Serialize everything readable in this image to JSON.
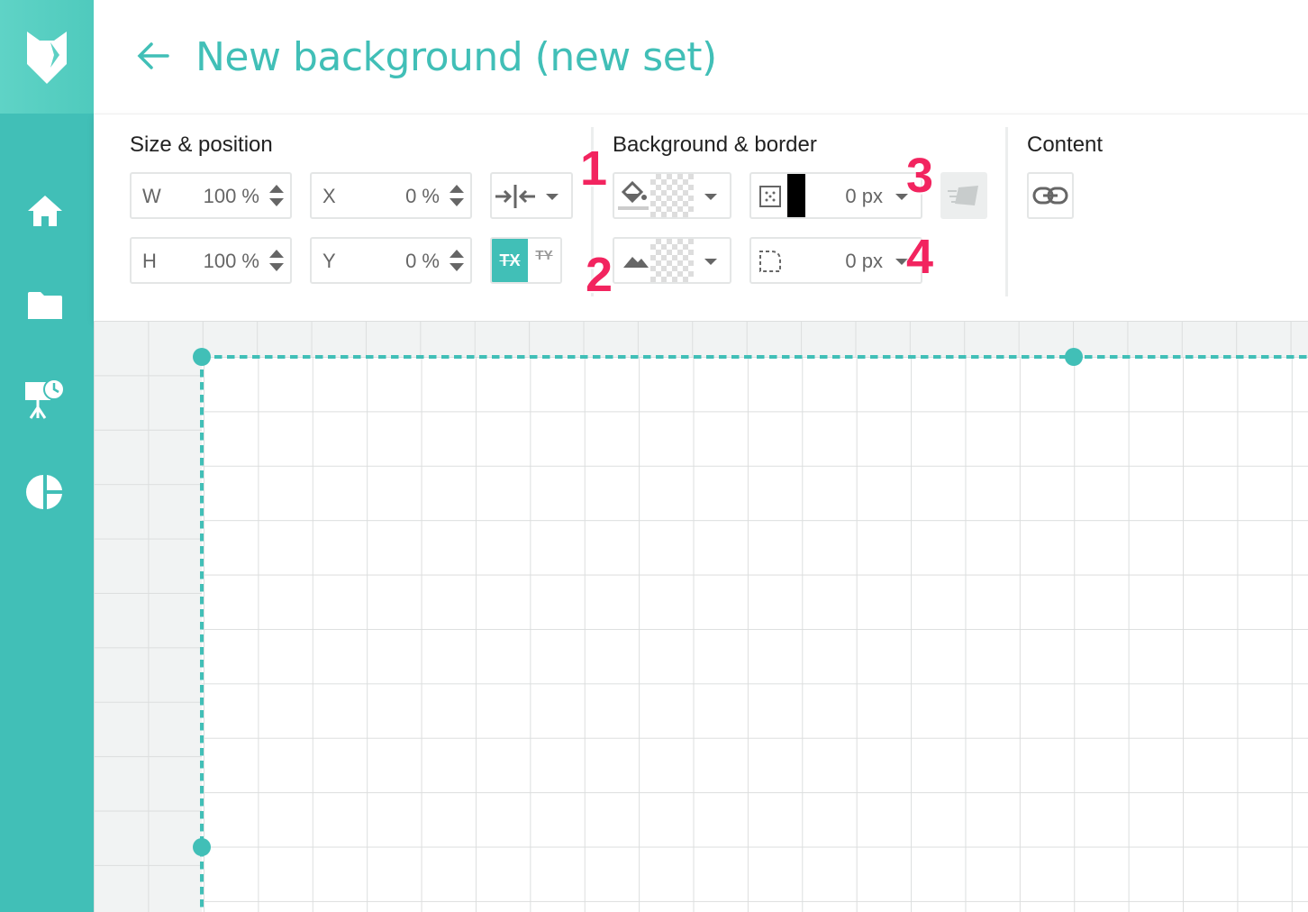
{
  "app": {
    "logo_icon": "fox-logo-icon",
    "accent_color": "#41bfb7",
    "sidebar_color": "#41bfb7"
  },
  "sidebar": {
    "items": [
      {
        "icon": "home-icon"
      },
      {
        "icon": "folder-icon"
      },
      {
        "icon": "presentation-schedule-icon"
      },
      {
        "icon": "pie-chart-icon"
      }
    ]
  },
  "header": {
    "back_icon": "arrow-left-icon",
    "title": "New background (new set)"
  },
  "toolbar": {
    "size_position": {
      "title": "Size & position",
      "width": {
        "label": "W",
        "value": "100 %"
      },
      "height": {
        "label": "H",
        "value": "100 %"
      },
      "x": {
        "label": "X",
        "value": "0 %"
      },
      "y": {
        "label": "Y",
        "value": "0 %"
      },
      "align_icon": "align-center-horizontal-icon",
      "tx_label": "TX",
      "ty_label": "TY"
    },
    "background_border": {
      "title": "Background & border",
      "fill_icon": "paint-bucket-icon",
      "image_icon": "image-mountain-icon",
      "border_icon": "border-style-icon",
      "border_color": "#000000",
      "border_width": "0 px",
      "radius_icon": "corner-radius-icon",
      "radius_value": "0 px",
      "shadow_icon": "shadow-icon"
    },
    "content": {
      "title": "Content",
      "link_icon": "link-icon"
    }
  },
  "annotations": [
    "1",
    "2",
    "3",
    "4"
  ]
}
